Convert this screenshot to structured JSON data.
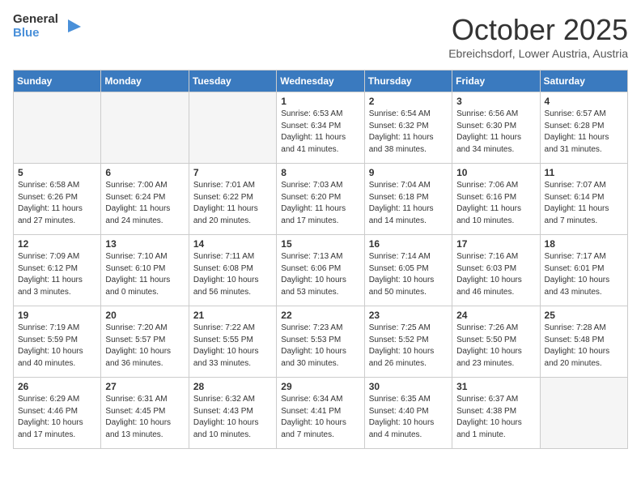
{
  "header": {
    "logo_general": "General",
    "logo_blue": "Blue",
    "month": "October 2025",
    "location": "Ebreichsdorf, Lower Austria, Austria"
  },
  "days_of_week": [
    "Sunday",
    "Monday",
    "Tuesday",
    "Wednesday",
    "Thursday",
    "Friday",
    "Saturday"
  ],
  "weeks": [
    [
      {
        "day": "",
        "empty": true
      },
      {
        "day": "",
        "empty": true
      },
      {
        "day": "",
        "empty": true
      },
      {
        "day": "1",
        "sunrise": "6:53 AM",
        "sunset": "6:34 PM",
        "daylight": "11 hours and 41 minutes."
      },
      {
        "day": "2",
        "sunrise": "6:54 AM",
        "sunset": "6:32 PM",
        "daylight": "11 hours and 38 minutes."
      },
      {
        "day": "3",
        "sunrise": "6:56 AM",
        "sunset": "6:30 PM",
        "daylight": "11 hours and 34 minutes."
      },
      {
        "day": "4",
        "sunrise": "6:57 AM",
        "sunset": "6:28 PM",
        "daylight": "11 hours and 31 minutes."
      }
    ],
    [
      {
        "day": "5",
        "sunrise": "6:58 AM",
        "sunset": "6:26 PM",
        "daylight": "11 hours and 27 minutes."
      },
      {
        "day": "6",
        "sunrise": "7:00 AM",
        "sunset": "6:24 PM",
        "daylight": "11 hours and 24 minutes."
      },
      {
        "day": "7",
        "sunrise": "7:01 AM",
        "sunset": "6:22 PM",
        "daylight": "11 hours and 20 minutes."
      },
      {
        "day": "8",
        "sunrise": "7:03 AM",
        "sunset": "6:20 PM",
        "daylight": "11 hours and 17 minutes."
      },
      {
        "day": "9",
        "sunrise": "7:04 AM",
        "sunset": "6:18 PM",
        "daylight": "11 hours and 14 minutes."
      },
      {
        "day": "10",
        "sunrise": "7:06 AM",
        "sunset": "6:16 PM",
        "daylight": "11 hours and 10 minutes."
      },
      {
        "day": "11",
        "sunrise": "7:07 AM",
        "sunset": "6:14 PM",
        "daylight": "11 hours and 7 minutes."
      }
    ],
    [
      {
        "day": "12",
        "sunrise": "7:09 AM",
        "sunset": "6:12 PM",
        "daylight": "11 hours and 3 minutes."
      },
      {
        "day": "13",
        "sunrise": "7:10 AM",
        "sunset": "6:10 PM",
        "daylight": "11 hours and 0 minutes."
      },
      {
        "day": "14",
        "sunrise": "7:11 AM",
        "sunset": "6:08 PM",
        "daylight": "10 hours and 56 minutes."
      },
      {
        "day": "15",
        "sunrise": "7:13 AM",
        "sunset": "6:06 PM",
        "daylight": "10 hours and 53 minutes."
      },
      {
        "day": "16",
        "sunrise": "7:14 AM",
        "sunset": "6:05 PM",
        "daylight": "10 hours and 50 minutes."
      },
      {
        "day": "17",
        "sunrise": "7:16 AM",
        "sunset": "6:03 PM",
        "daylight": "10 hours and 46 minutes."
      },
      {
        "day": "18",
        "sunrise": "7:17 AM",
        "sunset": "6:01 PM",
        "daylight": "10 hours and 43 minutes."
      }
    ],
    [
      {
        "day": "19",
        "sunrise": "7:19 AM",
        "sunset": "5:59 PM",
        "daylight": "10 hours and 40 minutes."
      },
      {
        "day": "20",
        "sunrise": "7:20 AM",
        "sunset": "5:57 PM",
        "daylight": "10 hours and 36 minutes."
      },
      {
        "day": "21",
        "sunrise": "7:22 AM",
        "sunset": "5:55 PM",
        "daylight": "10 hours and 33 minutes."
      },
      {
        "day": "22",
        "sunrise": "7:23 AM",
        "sunset": "5:53 PM",
        "daylight": "10 hours and 30 minutes."
      },
      {
        "day": "23",
        "sunrise": "7:25 AM",
        "sunset": "5:52 PM",
        "daylight": "10 hours and 26 minutes."
      },
      {
        "day": "24",
        "sunrise": "7:26 AM",
        "sunset": "5:50 PM",
        "daylight": "10 hours and 23 minutes."
      },
      {
        "day": "25",
        "sunrise": "7:28 AM",
        "sunset": "5:48 PM",
        "daylight": "10 hours and 20 minutes."
      }
    ],
    [
      {
        "day": "26",
        "sunrise": "6:29 AM",
        "sunset": "4:46 PM",
        "daylight": "10 hours and 17 minutes."
      },
      {
        "day": "27",
        "sunrise": "6:31 AM",
        "sunset": "4:45 PM",
        "daylight": "10 hours and 13 minutes."
      },
      {
        "day": "28",
        "sunrise": "6:32 AM",
        "sunset": "4:43 PM",
        "daylight": "10 hours and 10 minutes."
      },
      {
        "day": "29",
        "sunrise": "6:34 AM",
        "sunset": "4:41 PM",
        "daylight": "10 hours and 7 minutes."
      },
      {
        "day": "30",
        "sunrise": "6:35 AM",
        "sunset": "4:40 PM",
        "daylight": "10 hours and 4 minutes."
      },
      {
        "day": "31",
        "sunrise": "6:37 AM",
        "sunset": "4:38 PM",
        "daylight": "10 hours and 1 minute."
      },
      {
        "day": "",
        "empty": true
      }
    ]
  ]
}
